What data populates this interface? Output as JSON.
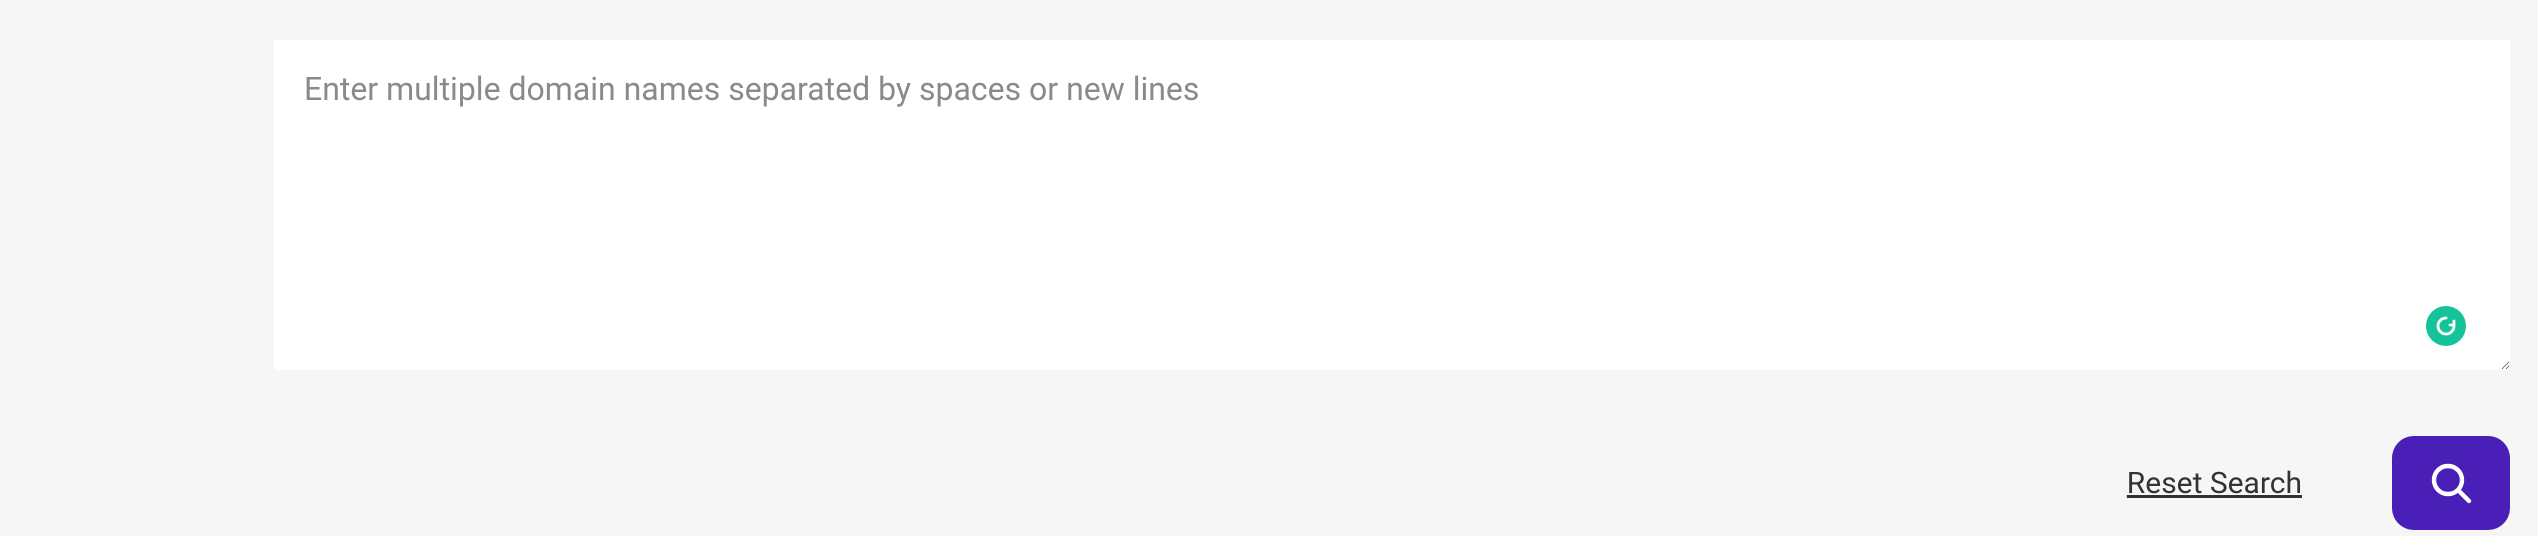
{
  "input": {
    "placeholder": "Enter multiple domain names separated by spaces or new lines",
    "value": ""
  },
  "actions": {
    "reset_label": "Reset Search"
  }
}
